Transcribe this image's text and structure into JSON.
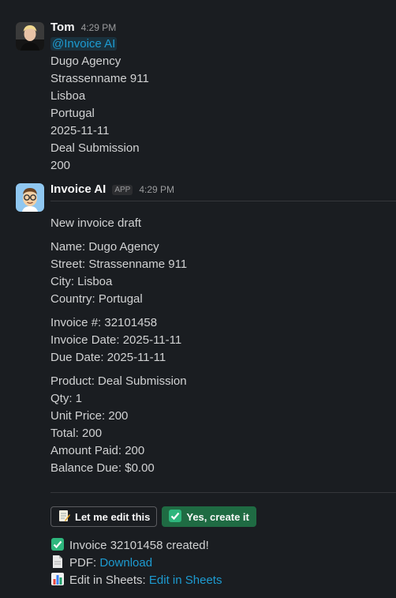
{
  "message1": {
    "author": "Tom",
    "time": "4:29 PM",
    "mention": "@Invoice AI",
    "lines": [
      "Dugo Agency",
      "Strassenname 911",
      "Lisboa",
      "Portugal",
      "2025-11-11",
      "Deal Submission",
      "200"
    ]
  },
  "message2": {
    "author": "Invoice AI",
    "badge": "APP",
    "time": "4:29 PM",
    "heading": "New invoice draft",
    "customer": [
      "Name: Dugo Agency",
      "Street: Strassenname 911",
      "City: Lisboa",
      "Country: Portugal"
    ],
    "invoice": [
      "Invoice #: 32101458",
      "Invoice Date: 2025-11-11",
      "Due Date: 2025-11-11"
    ],
    "items": [
      "Product: Deal Submission",
      "Qty: 1",
      "Unit Price: 200",
      "Total: 200",
      "Amount Paid: 200",
      "Balance Due: $0.00"
    ],
    "buttons": {
      "edit": "Let me edit this",
      "create": "Yes, create it"
    },
    "result": {
      "created": "Invoice 32101458 created!",
      "pdf_label": "PDF:",
      "pdf_link": "Download",
      "sheets_label": "Edit in Sheets:",
      "sheets_link": "Edit in Sheets"
    }
  },
  "icons": {
    "tom_avatar": "person-photo",
    "bot_avatar": "glasses-bot",
    "edit": "memo-icon",
    "create": "check-mark-icon",
    "created": "check-mark-icon",
    "pdf": "document-icon",
    "sheets": "bar-chart-icon"
  },
  "colors": {
    "background": "#1a1d21",
    "link": "#1d9bd1",
    "primary_button": "#1f6b43",
    "check": "#2eb67d"
  }
}
